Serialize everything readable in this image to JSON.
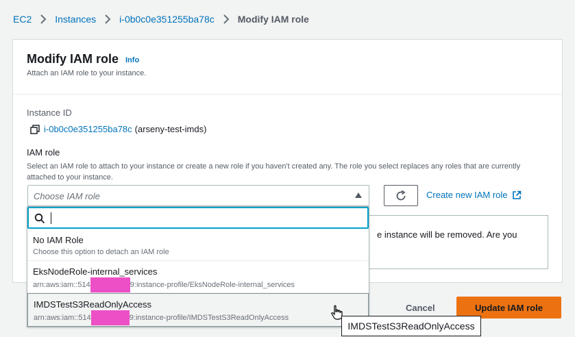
{
  "breadcrumb": {
    "items": [
      "EC2",
      "Instances",
      "i-0b0c0e351255ba78c"
    ],
    "current": "Modify IAM role"
  },
  "header": {
    "title": "Modify IAM role",
    "info": "Info",
    "subtitle": "Attach an IAM role to your instance."
  },
  "instance": {
    "label": "Instance ID",
    "id": "i-0b0c0e351255ba78c",
    "name": "(arseny-test-imds)"
  },
  "iam_role": {
    "label": "IAM role",
    "description": "Select an IAM role to attach to your instance or create a new role if you haven't created any. The role you select replaces any roles that are currently attached to your instance.",
    "placeholder": "Choose IAM role",
    "create_link": "Create new IAM role"
  },
  "alert": {
    "text": "e instance will be removed. Are you"
  },
  "dropdown": {
    "search_value": "",
    "options": [
      {
        "title": "No IAM Role",
        "desc_a": "Choose this option to detach an IAM role",
        "desc_b": ""
      },
      {
        "title": "EksNodeRole-internal_services",
        "desc_a": "arn:aws:iam::514",
        "desc_b": "9:instance-profile/EksNodeRole-internal_services"
      },
      {
        "title": "IMDSTestS3ReadOnlyAccess",
        "desc_a": "arn:aws:iam::514",
        "desc_b": "9:instance-profile/IMDSTestS3ReadOnlyAccess"
      }
    ]
  },
  "actions": {
    "cancel": "Cancel",
    "submit": "Update IAM role"
  },
  "tooltip": "IMDSTestS3ReadOnlyAccess",
  "colors": {
    "link": "#0073bb",
    "primary": "#ec7211",
    "focus": "#00a1c9",
    "redaction": "#ec4fc6"
  }
}
